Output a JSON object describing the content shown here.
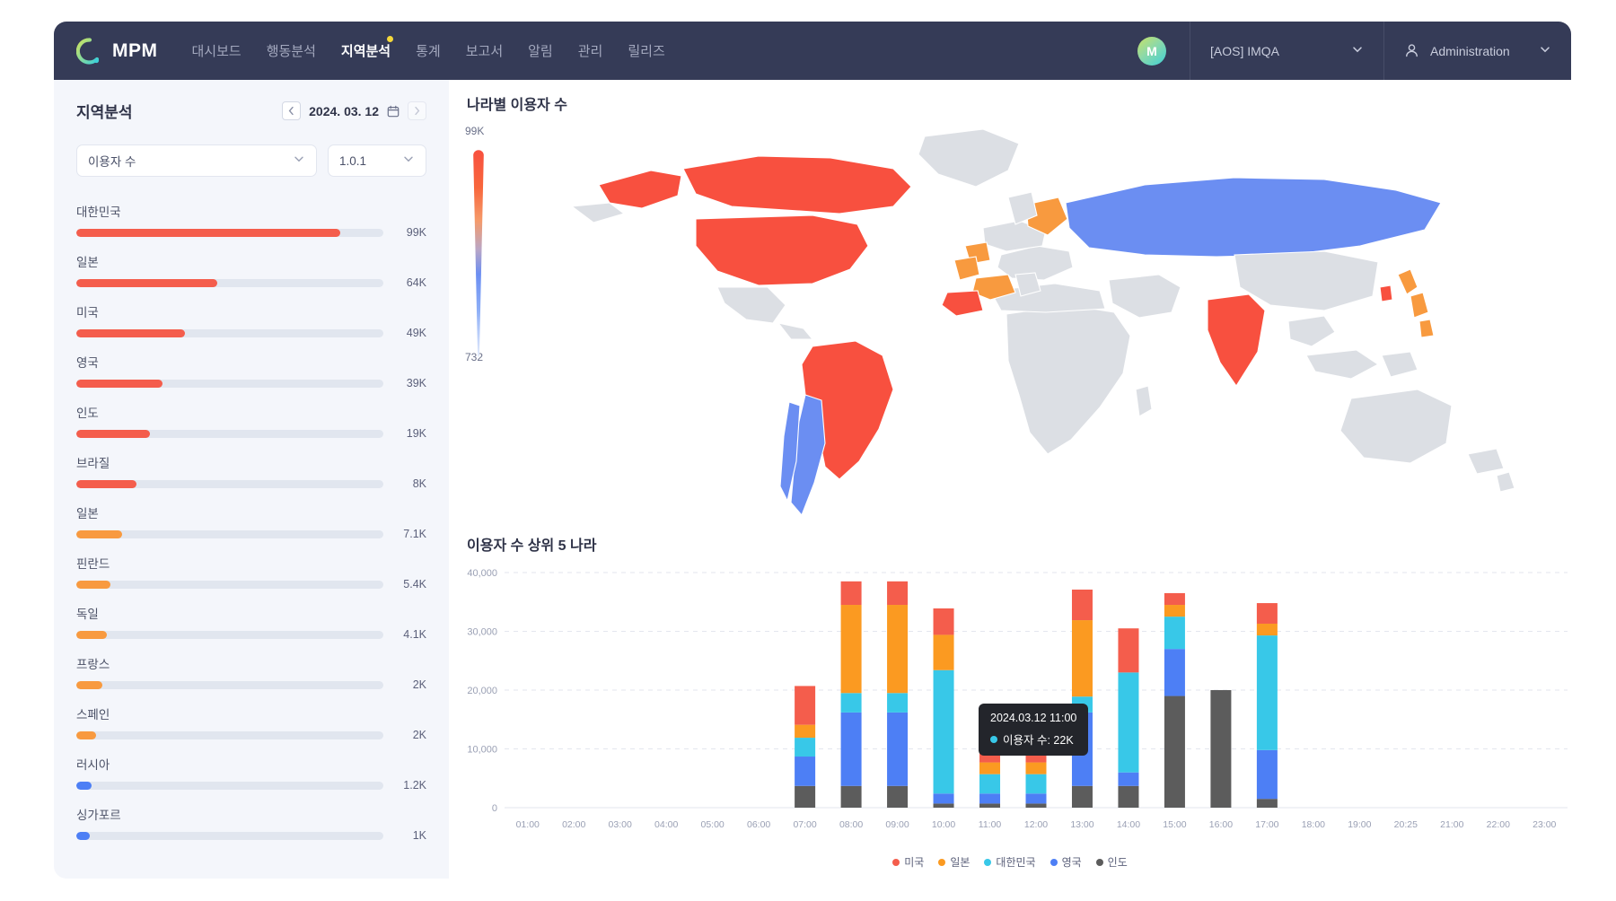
{
  "brand": {
    "name": "MPM",
    "logo_icon": "mpm-logo-icon"
  },
  "nav": {
    "items": [
      {
        "label": "대시보드",
        "active": false,
        "dot": false
      },
      {
        "label": "행동분석",
        "active": false,
        "dot": false
      },
      {
        "label": "지역분석",
        "active": true,
        "dot": true
      },
      {
        "label": "통계",
        "active": false,
        "dot": false
      },
      {
        "label": "보고서",
        "active": false,
        "dot": false
      },
      {
        "label": "알림",
        "active": false,
        "dot": false
      },
      {
        "label": "관리",
        "active": false,
        "dot": false
      },
      {
        "label": "릴리즈",
        "active": false,
        "dot": false
      }
    ],
    "avatar_initial": "M",
    "project_select": "[AOS] IMQA",
    "account_select": "Administration"
  },
  "sidebar": {
    "title": "지역분석",
    "date": "2024. 03. 12",
    "prev_icon": "chevron-left-icon",
    "next_icon": "chevron-right-icon",
    "calendar_icon": "calendar-icon",
    "metric_select": "이용자 수",
    "version_select": "1.0.1",
    "countries": [
      {
        "name": "대한민국",
        "value": "99K",
        "pct": 86.0,
        "color": "#f45d4c"
      },
      {
        "name": "일본",
        "value": "64K",
        "pct": 46.0,
        "color": "#f45d4c"
      },
      {
        "name": "미국",
        "value": "49K",
        "pct": 35.5,
        "color": "#f45d4c"
      },
      {
        "name": "영국",
        "value": "39K",
        "pct": 28.0,
        "color": "#f45d4c"
      },
      {
        "name": "인도",
        "value": "19K",
        "pct": 24.0,
        "color": "#f45d4c"
      },
      {
        "name": "브라질",
        "value": "8K",
        "pct": 19.5,
        "color": "#f45d4c"
      },
      {
        "name": "일본",
        "value": "7.1K",
        "pct": 15.0,
        "color": "#f89a3f"
      },
      {
        "name": "핀란드",
        "value": "5.4K",
        "pct": 11.0,
        "color": "#f89a3f"
      },
      {
        "name": "독일",
        "value": "4.1K",
        "pct": 10.0,
        "color": "#f89a3f"
      },
      {
        "name": "프랑스",
        "value": "2K",
        "pct": 8.5,
        "color": "#f89a3f"
      },
      {
        "name": "스페인",
        "value": "2K",
        "pct": 6.5,
        "color": "#f89a3f"
      },
      {
        "name": "러시아",
        "value": "1.2K",
        "pct": 5.0,
        "color": "#4d7ff5"
      },
      {
        "name": "싱가포르",
        "value": "1K",
        "pct": 4.5,
        "color": "#4d7ff5"
      }
    ]
  },
  "map_card": {
    "title": "나라별 이용자 수",
    "colorbar": {
      "max_label": "99K",
      "min_label": "732",
      "high_color": "#f8503f",
      "low_color": "#4d7ff5"
    },
    "country_fills": [
      {
        "name": "대한민국",
        "color": "#f8503f"
      },
      {
        "name": "일본",
        "color": "#f89a3f"
      },
      {
        "name": "미국",
        "color": "#f8503f"
      },
      {
        "name": "영국",
        "color": "#f89a3f"
      },
      {
        "name": "인도",
        "color": "#f8503f"
      },
      {
        "name": "브라질",
        "color": "#f8503f"
      },
      {
        "name": "러시아",
        "color": "#6b8ef2"
      },
      {
        "name": "캐나다",
        "color": "#f8503f"
      },
      {
        "name": "프랑스",
        "color": "#f89a3f"
      },
      {
        "name": "스페인",
        "color": "#f8503f"
      },
      {
        "name": "아르헨티나",
        "color": "#6b8ef2"
      },
      {
        "name": "칠레",
        "color": "#6b8ef2"
      }
    ]
  },
  "chart_data": {
    "type": "bar",
    "title": "이용자 수 상위 5 나라",
    "stacked": true,
    "xlabel": "",
    "ylabel": "",
    "ylim": [
      0,
      40000
    ],
    "yticks": [
      0,
      10000,
      20000,
      30000,
      40000
    ],
    "ytick_labels": [
      "0",
      "10,000",
      "20,000",
      "30,000",
      "40,000"
    ],
    "grid": true,
    "legend_position": "bottom",
    "categories": [
      "01:00",
      "02:00",
      "03:00",
      "04:00",
      "05:00",
      "06:00",
      "07:00",
      "08:00",
      "09:00",
      "10:00",
      "11:00",
      "12:00",
      "13:00",
      "14:00",
      "15:00",
      "16:00",
      "17:00",
      "18:00",
      "19:00",
      "20:25",
      "21:00",
      "22:00",
      "23:00"
    ],
    "series": [
      {
        "name": "인도",
        "color": "#5c5c5c",
        "values": [
          0,
          0,
          0,
          0,
          0,
          0,
          3700,
          3700,
          3700,
          700,
          700,
          700,
          3700,
          3700,
          19000,
          20000,
          1500,
          0,
          0,
          0,
          0,
          0,
          0
        ]
      },
      {
        "name": "영국",
        "color": "#4d7ff5",
        "values": [
          0,
          0,
          0,
          0,
          0,
          0,
          5000,
          12500,
          12500,
          1700,
          1700,
          1700,
          12500,
          2300,
          8000,
          0,
          8300,
          0,
          0,
          0,
          0,
          0,
          0
        ]
      },
      {
        "name": "대한민국",
        "color": "#38c8e8",
        "values": [
          0,
          0,
          0,
          0,
          0,
          0,
          3200,
          3300,
          3300,
          21000,
          3300,
          3300,
          2700,
          17000,
          5500,
          0,
          19500,
          0,
          0,
          0,
          0,
          0,
          0
        ]
      },
      {
        "name": "일본",
        "color": "#fb9a21",
        "values": [
          0,
          0,
          0,
          0,
          0,
          0,
          2200,
          15000,
          15000,
          6000,
          2000,
          2000,
          13000,
          0,
          2000,
          0,
          2000,
          0,
          0,
          0,
          0,
          0,
          0
        ]
      },
      {
        "name": "미국",
        "color": "#f45d4c",
        "values": [
          0,
          0,
          0,
          0,
          0,
          0,
          6600,
          4000,
          4000,
          4500,
          3000,
          3000,
          5200,
          7500,
          2000,
          0,
          3500,
          0,
          0,
          0,
          0,
          0,
          0
        ]
      }
    ],
    "legend": [
      {
        "name": "미국",
        "color": "#f45d4c"
      },
      {
        "name": "일본",
        "color": "#fb9a21"
      },
      {
        "name": "대한민국",
        "color": "#38c8e8"
      },
      {
        "name": "영국",
        "color": "#4d7ff5"
      },
      {
        "name": "인도",
        "color": "#5c5c5c"
      }
    ],
    "tooltip": {
      "time": "2024.03.12 11:00",
      "metric_label": "이용자 수: 22K",
      "dot_color": "#38c8e8"
    }
  }
}
